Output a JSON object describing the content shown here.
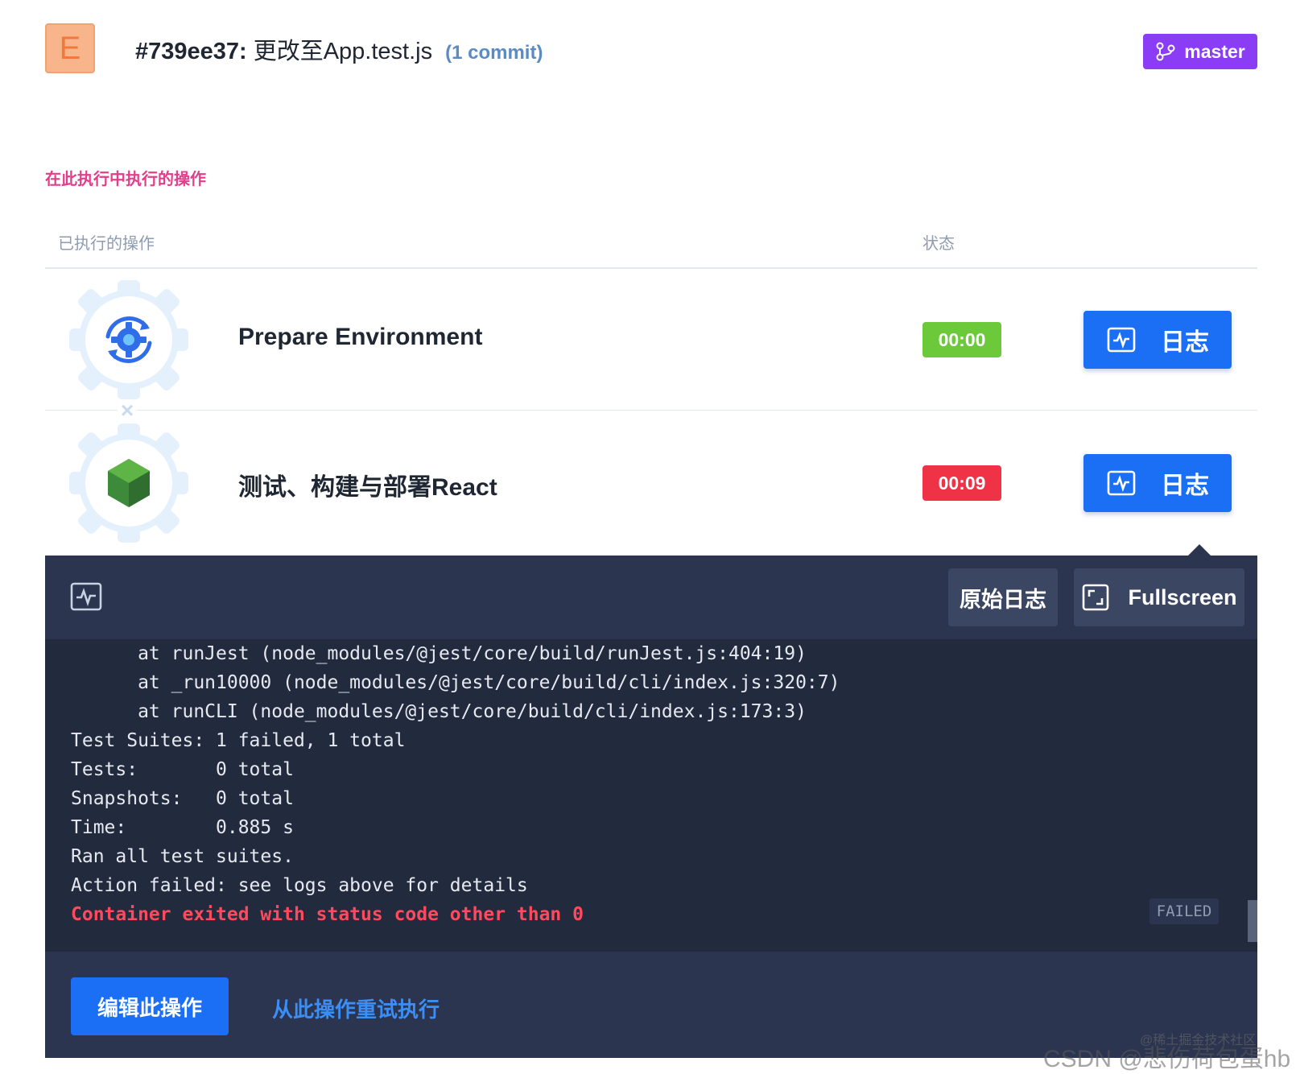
{
  "header": {
    "avatar_letter": "E",
    "commit_hash": "#739ee37:",
    "commit_message": "更改至App.test.js",
    "commit_count": "(1 commit)",
    "branch": "master"
  },
  "section": {
    "title": "在此执行中执行的操作",
    "col_operations": "已执行的操作",
    "col_status": "状态"
  },
  "steps": [
    {
      "name": "Prepare Environment",
      "time": "00:00",
      "status": "success",
      "log_label": "日志"
    },
    {
      "name": "测试、构建与部署React",
      "time": "00:09",
      "status": "failed",
      "log_label": "日志"
    }
  ],
  "log_panel": {
    "raw_log_label": "原始日志",
    "fullscreen_label": "Fullscreen",
    "lines": [
      "      at runJest (node_modules/@jest/core/build/runJest.js:404:19)",
      "      at _run10000 (node_modules/@jest/core/build/cli/index.js:320:7)",
      "      at runCLI (node_modules/@jest/core/build/cli/index.js:173:3)",
      "Test Suites: 1 failed, 1 total",
      "Tests:       0 total",
      "Snapshots:   0 total",
      "Time:        0.885 s",
      "Ran all test suites.",
      "Action failed: see logs above for details"
    ],
    "error_line": "Container exited with status code other than 0",
    "status_tag": "FAILED",
    "edit_label": "编辑此操作",
    "retry_label": "从此操作重试执行"
  },
  "watermark": {
    "small": "@稀土掘金技术社区",
    "big": "CSDN @悲伤荷包蛋hb"
  },
  "colors": {
    "branch_badge": "#8a3df5",
    "success": "#6cc93a",
    "failed": "#ef3246",
    "primary_button": "#1a6ff5",
    "panel_bg": "#2b3550",
    "console_bg": "#222a3e",
    "section_title": "#e23e8b"
  },
  "icons": {
    "branch": "git-branch-icon",
    "step1": "gear-sync-icon",
    "step2": "nodejs-hexagon-icon",
    "log": "activity-monitor-icon",
    "fullscreen": "expand-icon"
  }
}
